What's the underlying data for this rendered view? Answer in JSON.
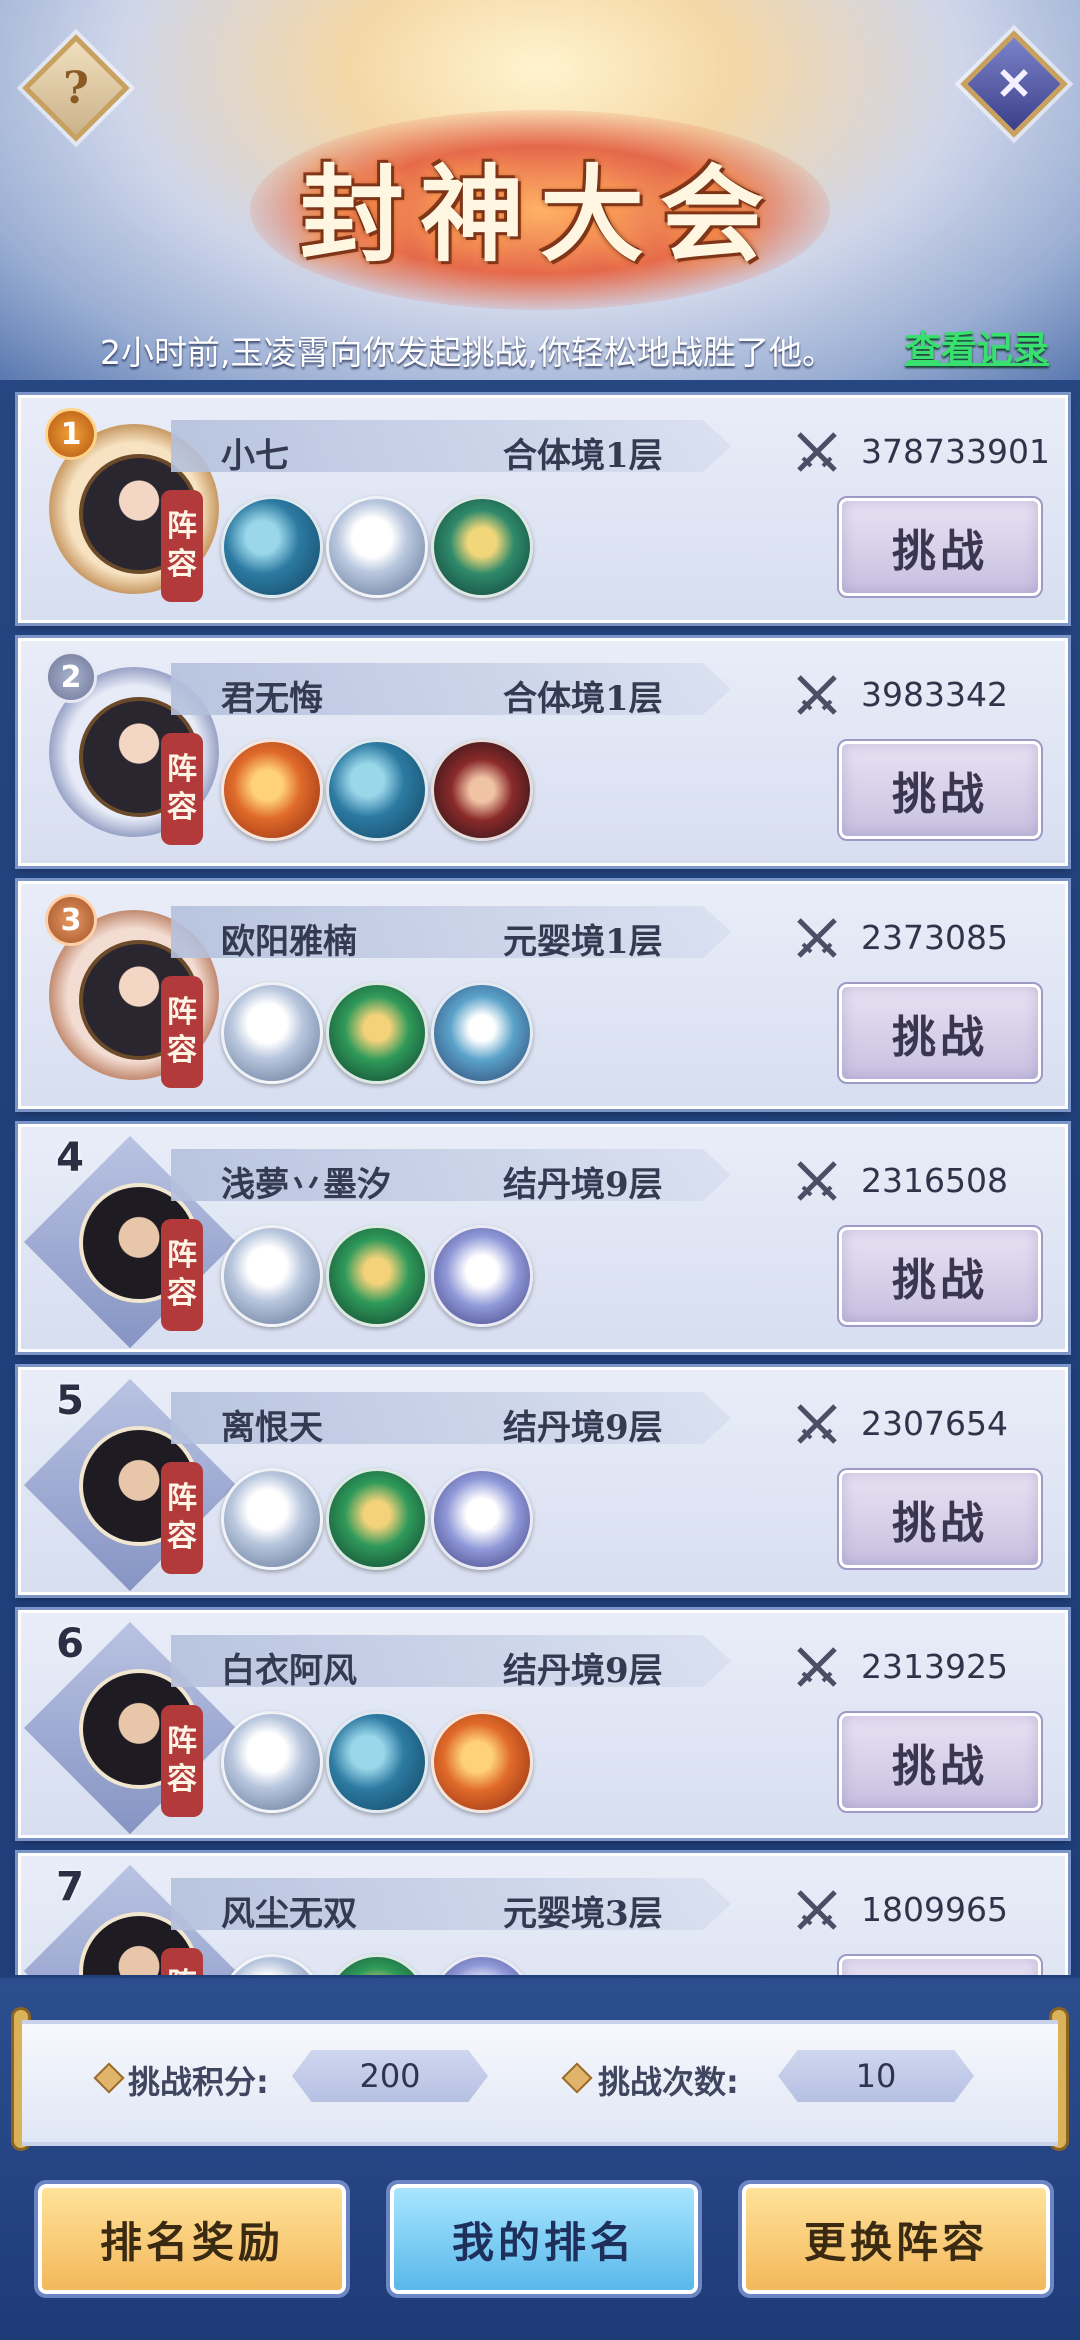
{
  "header": {
    "help_glyph": "?",
    "close_glyph": "✕",
    "title": "封神大会",
    "notice": "2小时前,玉凌霄向你发起挑战,你轻松地战胜了他。",
    "record_link": "查看记录"
  },
  "lineup_label": [
    "阵",
    "容"
  ],
  "challenge_label": "挑战",
  "players": [
    {
      "rank": "1",
      "name": "小七",
      "realm": "合体境1层",
      "power": "378733901",
      "frame": "gold",
      "beasts": [
        "whale",
        "tiger",
        "dragon-gold"
      ]
    },
    {
      "rank": "2",
      "name": "君无悔",
      "realm": "合体境1层",
      "power": "3983342",
      "frame": "silver",
      "beasts": [
        "dragon-red",
        "whale",
        "dragon-dark"
      ]
    },
    {
      "rank": "3",
      "name": "欧阳雅楠",
      "realm": "元婴境1层",
      "power": "2373085",
      "frame": "bronze",
      "beasts": [
        "tiger",
        "dragon-green",
        "dragon-blue"
      ]
    },
    {
      "rank": "4",
      "name": "浅夢丷墨汐",
      "realm": "结丹境9层",
      "power": "2316508",
      "frame": "plain",
      "beasts": [
        "tiger",
        "dragon-green",
        "wolf"
      ]
    },
    {
      "rank": "5",
      "name": "离恨天",
      "realm": "结丹境9层",
      "power": "2307654",
      "frame": "plain",
      "beasts": [
        "tiger",
        "dragon-green",
        "wolf"
      ]
    },
    {
      "rank": "6",
      "name": "白衣阿风",
      "realm": "结丹境9层",
      "power": "2313925",
      "frame": "plain",
      "beasts": [
        "tiger",
        "whale",
        "dragon-red"
      ]
    },
    {
      "rank": "7",
      "name": "风尘无双",
      "realm": "元婴境3层",
      "power": "1809965",
      "frame": "plain",
      "beasts": [
        "tiger",
        "dragon-green",
        "wolf"
      ]
    }
  ],
  "stats": {
    "score_label": "挑战积分:",
    "score_value": "200",
    "count_label": "挑战次数:",
    "count_value": "10"
  },
  "buttons": {
    "rewards": "排名奖励",
    "my_rank": "我的排名",
    "change_lineup": "更换阵容"
  }
}
